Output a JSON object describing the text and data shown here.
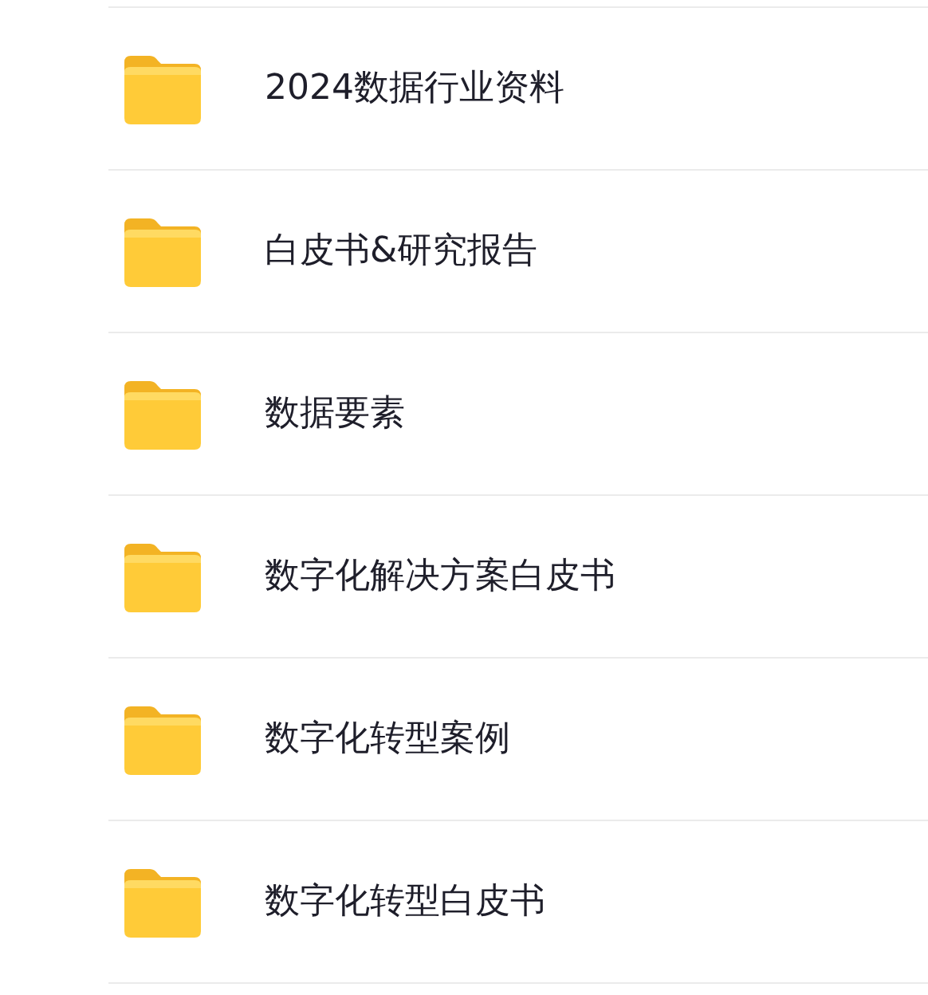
{
  "folders": [
    {
      "name": "2024数据行业资料"
    },
    {
      "name": "白皮书&研究报告"
    },
    {
      "name": "数据要素"
    },
    {
      "name": "数字化解决方案白皮书"
    },
    {
      "name": "数字化转型案例"
    },
    {
      "name": "数字化转型白皮书"
    }
  ]
}
